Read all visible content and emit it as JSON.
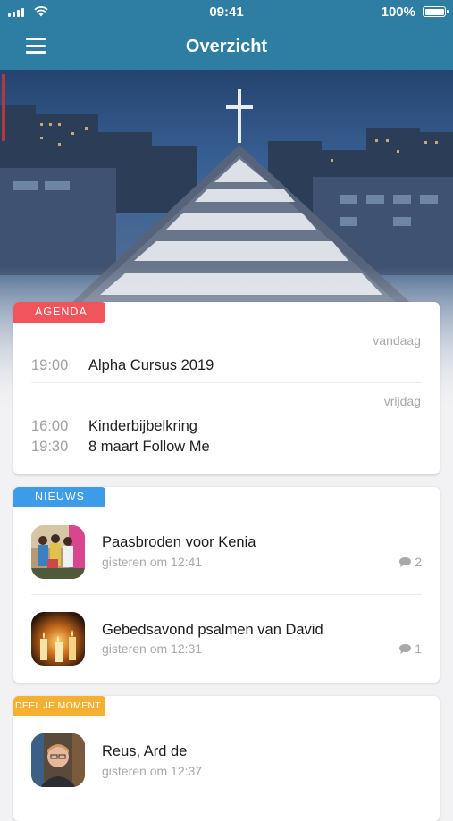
{
  "status_bar": {
    "time": "09:41",
    "battery": "100%"
  },
  "nav": {
    "title": "Overzicht"
  },
  "agenda": {
    "badge": "AGENDA",
    "groups": [
      {
        "day": "vandaag",
        "events": [
          {
            "time": "19:00",
            "title": "Alpha Cursus 2019"
          }
        ]
      },
      {
        "day": "vrijdag",
        "events": [
          {
            "time": "16:00",
            "title": "Kinderbijbelkring"
          },
          {
            "time": "19:30",
            "title": "8 maart Follow Me"
          }
        ]
      }
    ]
  },
  "news": {
    "badge": "NIEUWS",
    "items": [
      {
        "title": "Paasbroden voor Kenia",
        "meta": "gisteren om 12:41",
        "comments": "2"
      },
      {
        "title": "Gebedsavond psalmen van David",
        "meta": "gisteren om 12:31",
        "comments": "1"
      }
    ]
  },
  "moment": {
    "badge": "DEEL JE MOMENT",
    "items": [
      {
        "title": "Reus, Ard de",
        "meta": "gisteren om 12:37"
      }
    ]
  },
  "colors": {
    "header": "#2e7ea3",
    "agenda_badge": "#f2545b",
    "news_badge": "#3d9ce7",
    "moment_badge": "#f6b031"
  },
  "icons": [
    "menu-icon",
    "wifi-icon",
    "signal-icon",
    "battery-icon",
    "comment-icon"
  ]
}
